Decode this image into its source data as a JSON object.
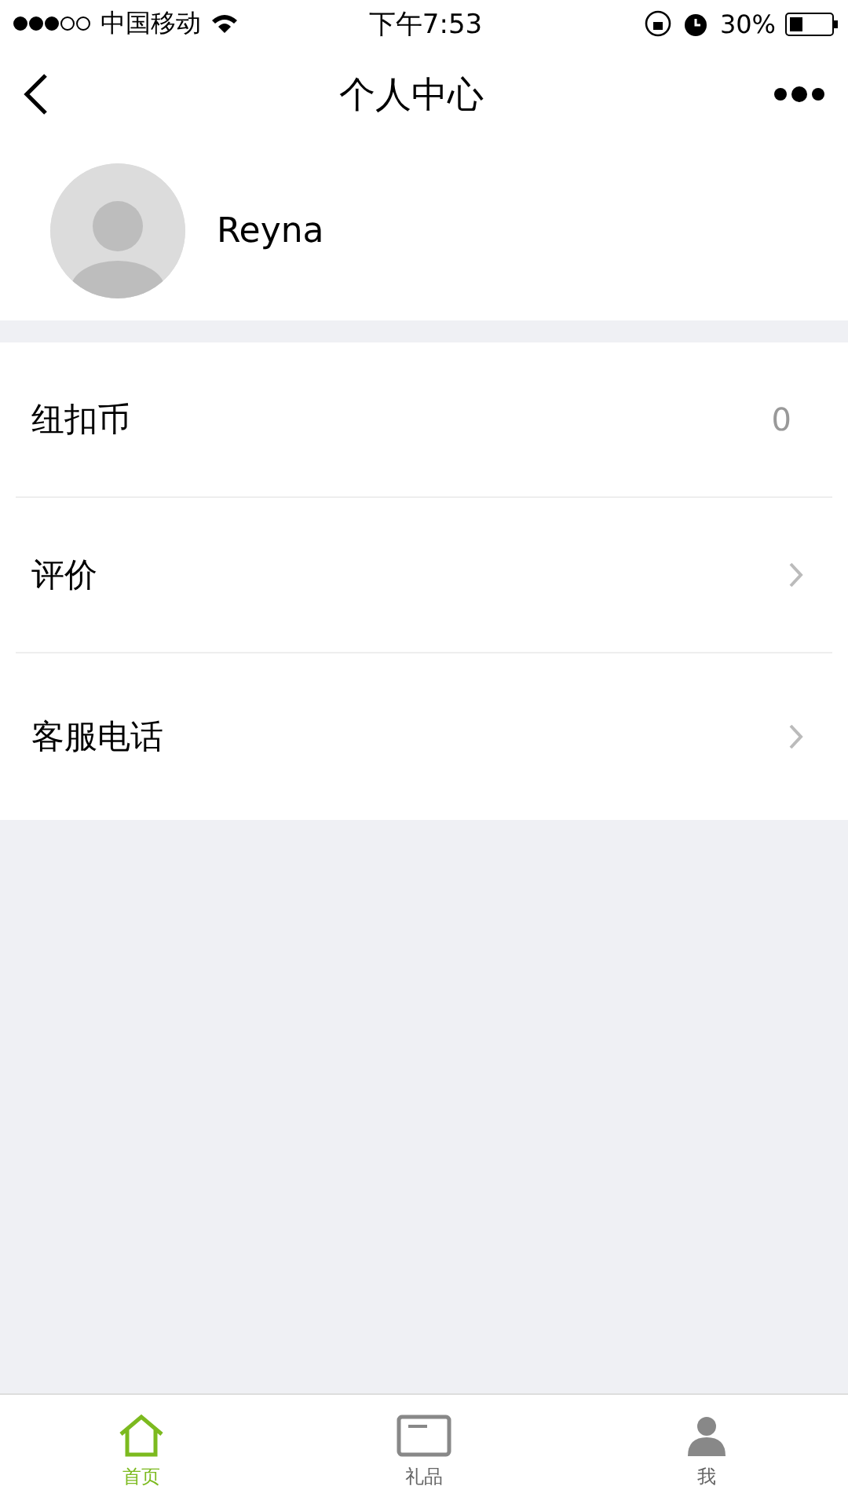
{
  "status_bar": {
    "carrier": "中国移动",
    "time": "下午7:53",
    "battery": "30%"
  },
  "nav": {
    "title": "个人中心"
  },
  "profile": {
    "name": "Reyna"
  },
  "menu": [
    {
      "kind": "value",
      "label": "纽扣币",
      "value": "0"
    },
    {
      "kind": "link",
      "label": "评价"
    },
    {
      "kind": "link",
      "label": "客服电话"
    }
  ],
  "tabs": [
    {
      "label": "首页",
      "selected": true
    },
    {
      "label": "礼品",
      "selected": false
    },
    {
      "label": "我",
      "selected": false
    }
  ]
}
